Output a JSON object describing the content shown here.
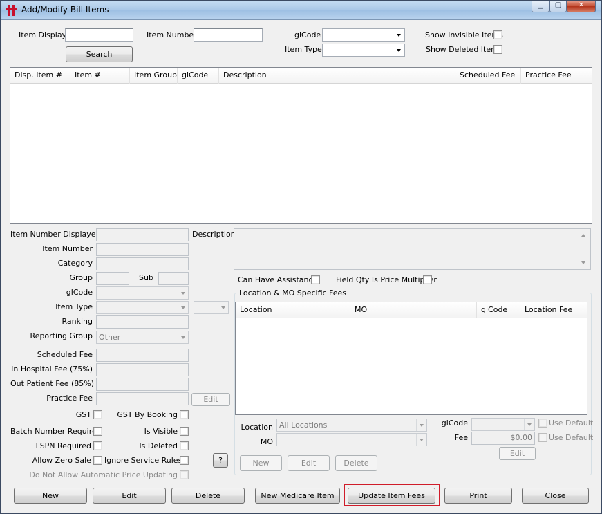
{
  "window": {
    "title": "Add/Modify Bill Items"
  },
  "search": {
    "item_display_label": "Item Display",
    "item_display_value": "",
    "item_number_label": "Item Number",
    "item_number_value": "",
    "glcode_label": "glCode",
    "glcode_value": "",
    "item_type_label": "Item Type",
    "item_type_value": "",
    "show_invisible_label": "Show Invisible Items",
    "show_deleted_label": "Show Deleted Items",
    "search_button": "Search"
  },
  "results_table": {
    "columns": [
      "Disp. Item #",
      "Item #",
      "Item Group",
      "glCode",
      "Description",
      "Scheduled Fee",
      "Practice Fee"
    ],
    "rows": []
  },
  "detail": {
    "item_number_displayed_label": "Item Number Displayed",
    "item_number_label": "Item Number",
    "category_label": "Category",
    "group_label": "Group",
    "sub_label": "Sub",
    "glcode_label": "glCode",
    "item_type_label": "Item Type",
    "ranking_label": "Ranking",
    "reporting_group_label": "Reporting Group",
    "reporting_group_value": "Other",
    "scheduled_fee_label": "Scheduled Fee",
    "in_hospital_fee_label": "In Hospital Fee (75%)",
    "out_patient_fee_label": "Out Patient Fee (85%)",
    "practice_fee_label": "Practice Fee",
    "edit_button": "Edit",
    "description_label": "Description",
    "gst_label": "GST",
    "gst_by_booking_label": "GST By Booking",
    "batch_number_required_label": "Batch Number Required",
    "is_visible_label": "Is Visible",
    "lspn_required_label": "LSPN Required",
    "is_deleted_label": "Is Deleted",
    "allow_zero_sale_label": "Allow Zero Sale",
    "ignore_service_rules_label": "Ignore Service Rules",
    "help_button": "?",
    "no_auto_price_label": "Do Not Allow Automatic Price Updating",
    "can_have_assistance_label": "Can Have Assistance",
    "field_qty_label": "Field Qty Is Price Multiplier"
  },
  "location_fees": {
    "group_title": "Location & MO Specific Fees",
    "columns": [
      "Location",
      "MO",
      "glCode",
      "Location Fee"
    ],
    "rows": [],
    "location_label": "Location",
    "location_value": "All Locations",
    "mo_label": "MO",
    "mo_value": "",
    "glcode_label": "glCode",
    "fee_label": "Fee",
    "fee_value": "$0.00",
    "use_default_label_1": "Use Default",
    "use_default_label_2": "Use Default",
    "edit_button": "Edit",
    "new_button": "New",
    "edit_button_2": "Edit",
    "delete_button": "Delete"
  },
  "footer": {
    "new": "New",
    "edit": "Edit",
    "delete": "Delete",
    "new_medicare": "New Medicare Item",
    "update_fees": "Update Item Fees",
    "print": "Print",
    "close": "Close"
  },
  "colors": {
    "highlight": "#d01c2a",
    "app_icon": "#c8102e"
  },
  "icons": {
    "app": "medical-cross-icon",
    "minimize": "minimize-icon",
    "maximize": "maximize-icon",
    "close": "close-icon"
  }
}
